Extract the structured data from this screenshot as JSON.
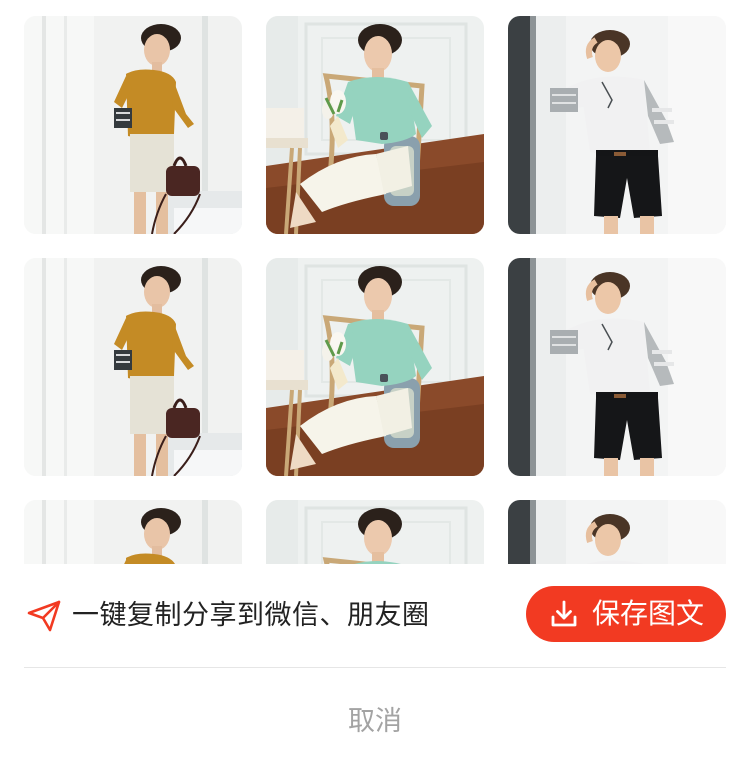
{
  "photos": [
    {
      "name": "photo-mustard-shirt-handbag",
      "scene": "mustard"
    },
    {
      "name": "photo-mint-shirt-bouquet",
      "scene": "mint"
    },
    {
      "name": "photo-white-shirt-black-shorts",
      "scene": "white"
    },
    {
      "name": "photo-mustard-shirt-handbag",
      "scene": "mustard"
    },
    {
      "name": "photo-mint-shirt-bouquet",
      "scene": "mint"
    },
    {
      "name": "photo-white-shirt-black-shorts",
      "scene": "white"
    },
    {
      "name": "photo-mustard-shirt-handbag",
      "scene": "mustard"
    },
    {
      "name": "photo-mint-shirt-bouquet",
      "scene": "mint"
    },
    {
      "name": "photo-white-shirt-black-shorts",
      "scene": "white"
    }
  ],
  "share": {
    "icon": "paper-plane-icon",
    "text": "一键复制分享到微信、朋友圈"
  },
  "save_button": {
    "icon": "download-icon",
    "label": "保存图文"
  },
  "cancel_button": {
    "label": "取消"
  },
  "colors": {
    "accent": "#f23a22",
    "text": "#222222",
    "muted": "#a3a3a3",
    "divider": "#e6e6e6"
  }
}
